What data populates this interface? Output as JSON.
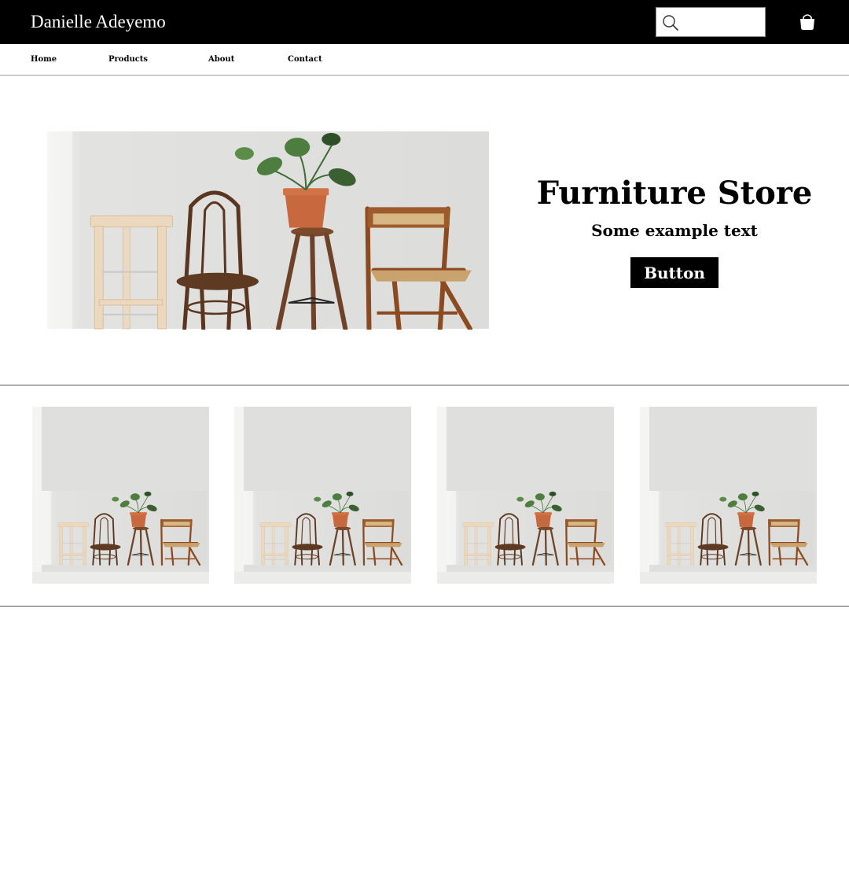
{
  "header": {
    "brand": "Danielle Adeyemo",
    "search": {
      "placeholder": "",
      "value": "",
      "icon": "search-icon"
    },
    "cart_icon": "shopping-bag-icon",
    "background": "#000000"
  },
  "nav": {
    "items": [
      {
        "label": "Home"
      },
      {
        "label": "Products"
      },
      {
        "label": "About"
      },
      {
        "label": "Contact"
      }
    ]
  },
  "hero": {
    "title": "Furniture Store",
    "subtitle": "Some example text",
    "button_label": "Button",
    "image": "photo-four-chairs-and-potted-plant-against-white-wall"
  },
  "products": {
    "images": [
      "photo-four-chairs-and-potted-plant",
      "photo-four-chairs-and-potted-plant",
      "photo-four-chairs-and-potted-plant",
      "photo-four-chairs-and-potted-plant"
    ]
  }
}
